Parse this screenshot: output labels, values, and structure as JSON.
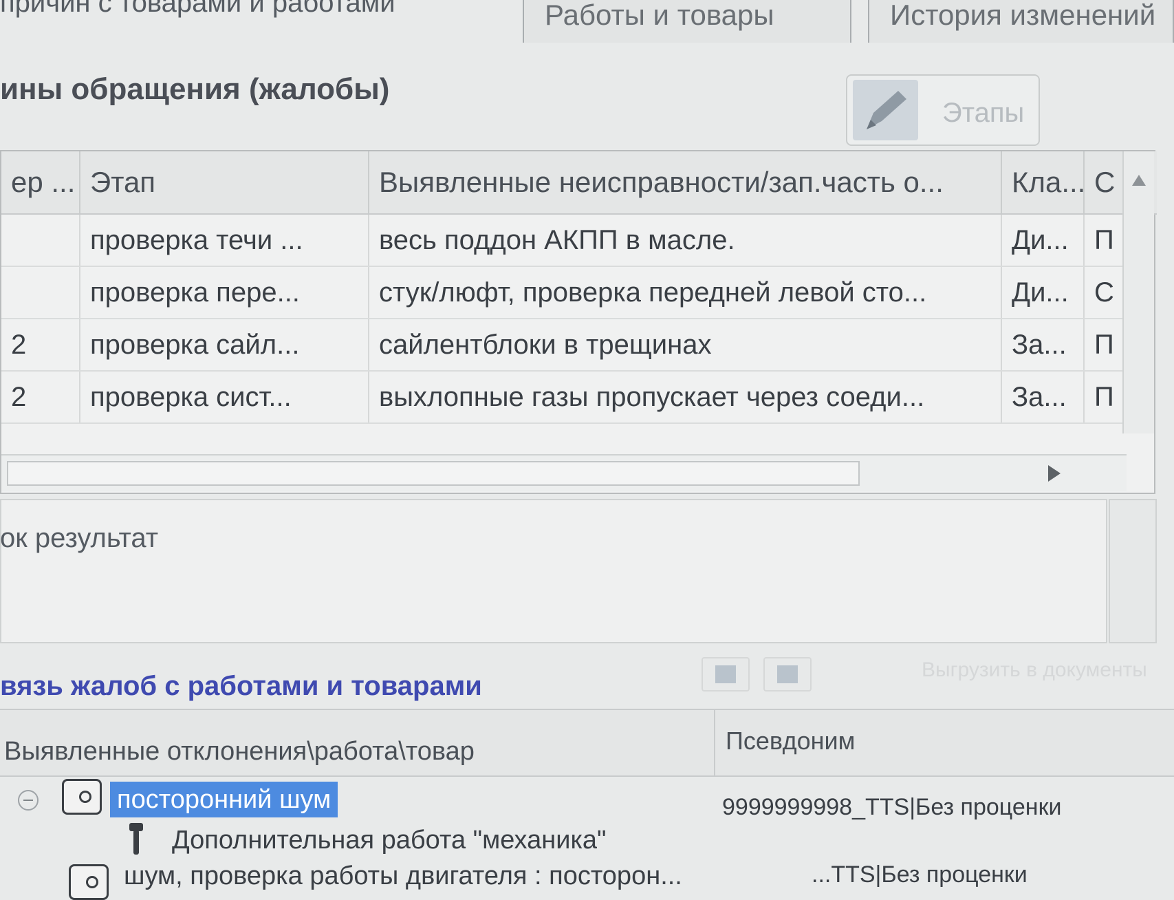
{
  "tabs": {
    "left_label": "причин с товарами и работами",
    "works_label": "Работы и товары",
    "history_label": "История изменений"
  },
  "complaints": {
    "title": "ины обращения (жалобы)",
    "stages_button": "Этапы",
    "columns": [
      "ер ...",
      "Этап",
      "Выявленные неисправности/зап.часть о...",
      "Кла...",
      "С"
    ],
    "rows": [
      {
        "num": "",
        "stage": "проверка течи ...",
        "fault": "весь поддон АКПП в масле.",
        "cls": "Ди...",
        "s": "П"
      },
      {
        "num": "",
        "stage": "проверка пере...",
        "fault": "стук/люфт, проверка передней левой сто...",
        "cls": "Ди...",
        "s": "С"
      },
      {
        "num": "2",
        "stage": "проверка сайл...",
        "fault": "сайлентблоки в трещинах",
        "cls": "За...",
        "s": "П"
      },
      {
        "num": "2",
        "stage": "проверка сист...",
        "fault": "выхлопные газы пропускает через соеди...",
        "cls": "За...",
        "s": "П"
      }
    ]
  },
  "result": {
    "label": "ок результат"
  },
  "link": {
    "title": "вязь жалоб с работами и товарами",
    "export_label": "Выгрузить в документы",
    "col_deviation": "Выявленные отклонения\\работа\\товар",
    "col_alias": "Псевдоним",
    "tree": [
      {
        "label": "посторонний шум",
        "alias": "9999999998_TTS|Без проценки"
      },
      {
        "label": "Дополнительная работа \"механика\"",
        "alias": ""
      },
      {
        "label": "шум, проверка работы двигателя : посторон...",
        "alias": "...TTS|Без проценки"
      }
    ]
  },
  "icons": {
    "stages": "pencil-icon",
    "node_search": "search-document-icon",
    "node_work": "wrench-icon"
  }
}
